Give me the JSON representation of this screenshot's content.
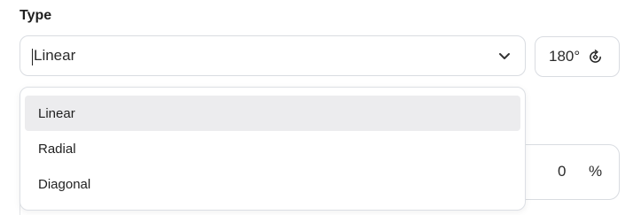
{
  "section": {
    "title": "Type"
  },
  "type_select": {
    "value": "Linear",
    "icon": "chevron-down-icon"
  },
  "angle": {
    "value": "180°",
    "icon": "rotate-icon"
  },
  "position_field": {
    "value": "0",
    "unit": "%"
  },
  "dropdown": {
    "options": [
      {
        "label": "Linear",
        "highlighted": true
      },
      {
        "label": "Radial",
        "highlighted": false
      },
      {
        "label": "Diagonal",
        "highlighted": false
      }
    ]
  },
  "colors": {
    "border": "#d9dce1",
    "highlight": "#ececee",
    "text": "#1f1f1f"
  }
}
